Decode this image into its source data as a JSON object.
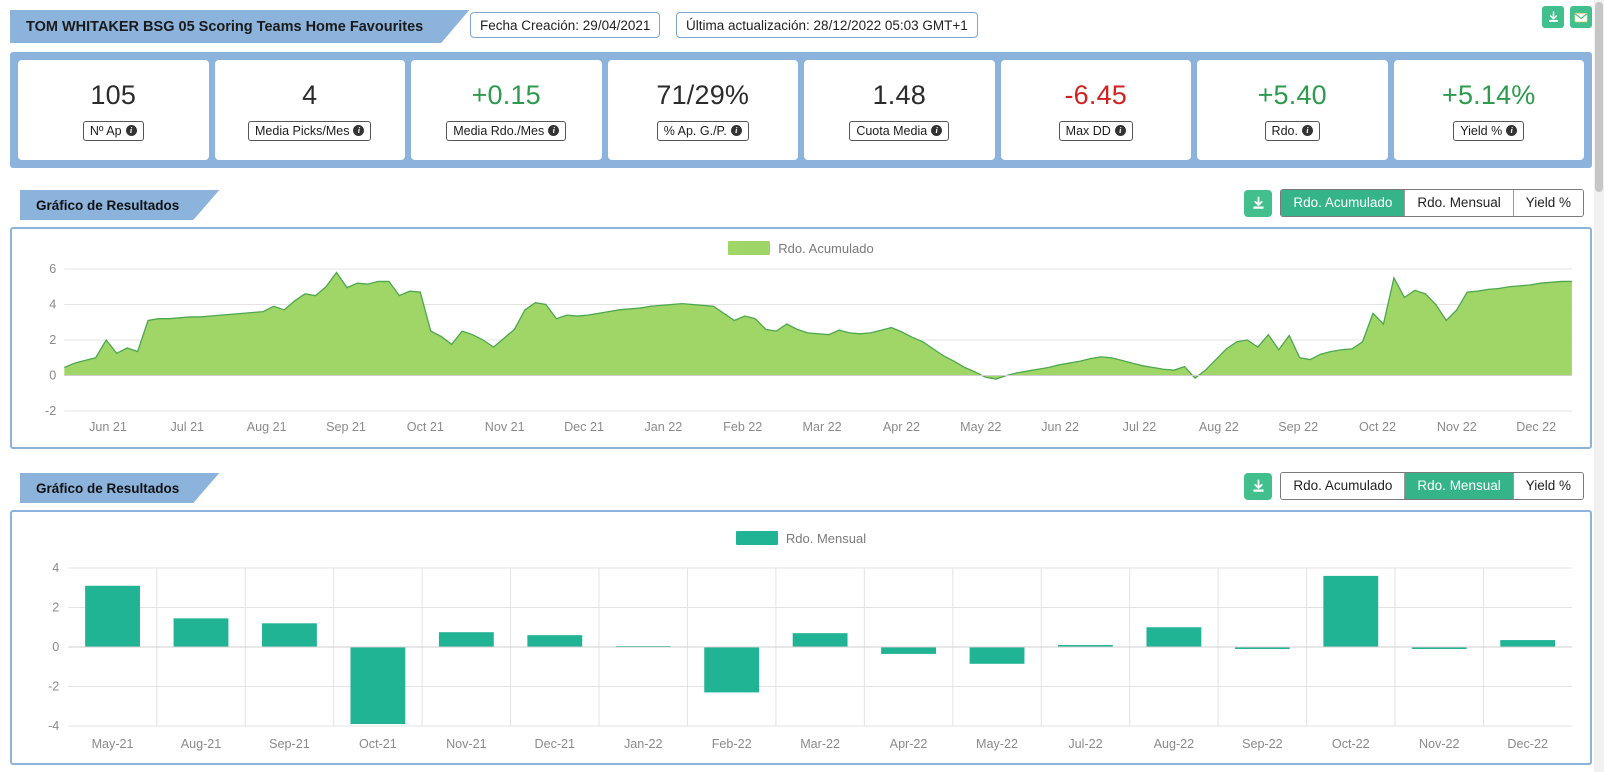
{
  "header": {
    "title": "TOM WHITAKER BSG 05 Scoring Teams Home Favourites",
    "creation": "Fecha Creación: 29/04/2021",
    "updated": "Última actualización: 28/12/2022 05:03 GMT+1",
    "download_icon": "download-icon",
    "email_icon": "email-icon"
  },
  "kpis": [
    {
      "value": "105",
      "label": "Nº Ap",
      "tone": "neutral"
    },
    {
      "value": "4",
      "label": "Media Picks/Mes",
      "tone": "neutral"
    },
    {
      "value": "+0.15",
      "label": "Media Rdo./Mes",
      "tone": "pos"
    },
    {
      "value": "71/29%",
      "label": "% Ap. G./P.",
      "tone": "neutral"
    },
    {
      "value": "1.48",
      "label": "Cuota Media",
      "tone": "neutral"
    },
    {
      "value": "-6.45",
      "label": "Max DD",
      "tone": "neg"
    },
    {
      "value": "+5.40",
      "label": "Rdo.",
      "tone": "pos"
    },
    {
      "value": "+5.14%",
      "label": "Yield %",
      "tone": "pos"
    }
  ],
  "panel1": {
    "tab_title": "Gráfico de Resultados",
    "download_icon": "download-icon",
    "tabs": [
      {
        "label": "Rdo. Acumulado",
        "active": true
      },
      {
        "label": "Rdo. Mensual",
        "active": false
      },
      {
        "label": "Yield %",
        "active": false
      }
    ]
  },
  "panel2": {
    "tab_title": "Gráfico de Resultados",
    "download_icon": "download-icon",
    "tabs": [
      {
        "label": "Rdo. Acumulado",
        "active": false
      },
      {
        "label": "Rdo. Mensual",
        "active": true
      },
      {
        "label": "Yield %",
        "active": false
      }
    ]
  },
  "colors": {
    "brand_blue": "#8cb3dc",
    "green_accent": "#35b48a",
    "area_fill": "#9fd667",
    "bar_fill": "#20b394",
    "positive": "#2e9a4e",
    "negative": "#d32020"
  },
  "chart_data": [
    {
      "type": "area",
      "title": "",
      "legend": [
        "Rdo. Acumulado"
      ],
      "legend_position": "top-center",
      "xlabel": "",
      "ylabel": "",
      "ylim": [
        -2,
        6
      ],
      "yticks": [
        6,
        4,
        2,
        0,
        -2
      ],
      "grid": true,
      "xtick_labels": [
        "Jun 21",
        "Jul 21",
        "Aug 21",
        "Sep 21",
        "Oct 21",
        "Nov 21",
        "Dec 21",
        "Jan 22",
        "Feb 22",
        "Mar 22",
        "Apr 22",
        "May 22",
        "Jun 22",
        "Jul 22",
        "Aug 22",
        "Sep 22",
        "Oct 22",
        "Nov 22",
        "Dec 22"
      ],
      "series": [
        {
          "name": "Rdo. Acumulado",
          "values": [
            0.45,
            0.7,
            0.85,
            1.0,
            2.0,
            1.25,
            1.55,
            1.35,
            3.1,
            3.2,
            3.2,
            3.25,
            3.3,
            3.3,
            3.35,
            3.4,
            3.45,
            3.5,
            3.55,
            3.6,
            3.9,
            3.7,
            4.2,
            4.6,
            4.5,
            5.0,
            5.8,
            4.95,
            5.2,
            5.15,
            5.3,
            5.3,
            4.5,
            4.75,
            4.7,
            2.5,
            2.2,
            1.75,
            2.5,
            2.3,
            2.0,
            1.6,
            2.1,
            2.6,
            3.7,
            4.1,
            4.0,
            3.2,
            3.4,
            3.35,
            3.4,
            3.5,
            3.6,
            3.7,
            3.75,
            3.8,
            3.9,
            3.95,
            4.0,
            4.05,
            4.0,
            3.95,
            3.9,
            3.5,
            3.1,
            3.35,
            3.2,
            2.6,
            2.5,
            2.9,
            2.6,
            2.4,
            2.35,
            2.3,
            2.55,
            2.4,
            2.35,
            2.4,
            2.55,
            2.7,
            2.45,
            2.15,
            1.9,
            1.5,
            1.1,
            0.8,
            0.45,
            0.2,
            -0.1,
            -0.2,
            0.0,
            0.15,
            0.25,
            0.35,
            0.45,
            0.6,
            0.7,
            0.8,
            0.95,
            1.05,
            1.0,
            0.85,
            0.7,
            0.55,
            0.45,
            0.35,
            0.3,
            0.5,
            -0.15,
            0.3,
            0.9,
            1.5,
            1.9,
            2.0,
            1.6,
            2.3,
            1.45,
            2.25,
            1.0,
            0.9,
            1.2,
            1.35,
            1.45,
            1.5,
            1.9,
            3.5,
            2.9,
            5.5,
            4.4,
            4.8,
            4.6,
            4.0,
            3.1,
            3.7,
            4.7,
            4.75,
            4.85,
            4.9,
            5.0,
            5.05,
            5.1,
            5.2,
            5.25,
            5.3,
            5.3
          ]
        }
      ]
    },
    {
      "type": "bar",
      "title": "",
      "legend": [
        "Rdo. Mensual"
      ],
      "legend_position": "top-center",
      "xlabel": "",
      "ylabel": "",
      "ylim": [
        -4,
        4
      ],
      "yticks": [
        4,
        2,
        0,
        -2,
        -4
      ],
      "grid": true,
      "categories": [
        "May-21",
        "Aug-21",
        "Sep-21",
        "Oct-21",
        "Nov-21",
        "Dec-21",
        "Jan-22",
        "Feb-22",
        "Mar-22",
        "Apr-22",
        "May-22",
        "Jul-22",
        "Aug-22",
        "Sep-22",
        "Oct-22",
        "Nov-22",
        "Dec-22"
      ],
      "series": [
        {
          "name": "Rdo. Mensual",
          "values": [
            3.1,
            1.45,
            1.2,
            -3.9,
            0.75,
            0.6,
            0.05,
            -2.3,
            0.7,
            -0.35,
            -0.85,
            0.1,
            1.0,
            -0.1,
            3.6,
            -0.1,
            0.35
          ]
        }
      ]
    }
  ]
}
